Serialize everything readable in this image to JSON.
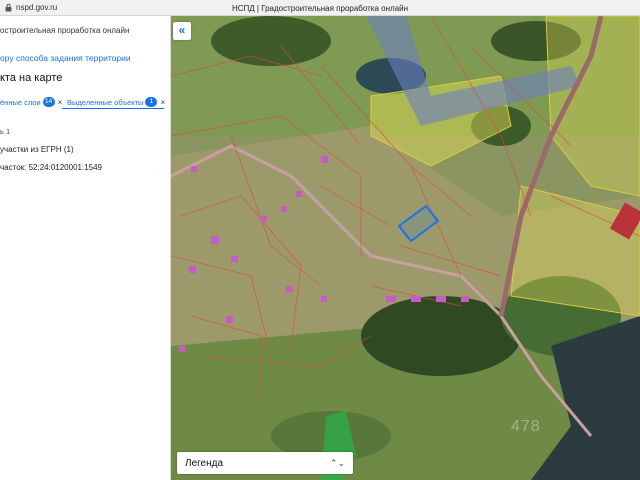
{
  "browser": {
    "url": "nspd.gov.ru",
    "title": "НСПД | Градостроительная проработка онлайн"
  },
  "sidebar": {
    "app_title": "остроительная проработка онлайн",
    "back_link": "ору способа задания территории",
    "heading": "кта на карте",
    "tabs": [
      {
        "label": "ённые слои",
        "count": "14",
        "close": "×"
      },
      {
        "label": "Выделенные объекты",
        "count": "1",
        "close": "×"
      }
    ],
    "count_text": "ь 1",
    "group_label": "участки из ЕГРН (1)",
    "item_label": "часток: 52:24:0120001:1549"
  },
  "map": {
    "collapse_icon": "«",
    "legend_label": "Легенда",
    "legend_arrow": "⌃⌄",
    "selected_parcel_color": "#1a73e8",
    "parcel_outline_color": "#e0464b",
    "zone_color": "#e6e055",
    "watermark": "478"
  }
}
